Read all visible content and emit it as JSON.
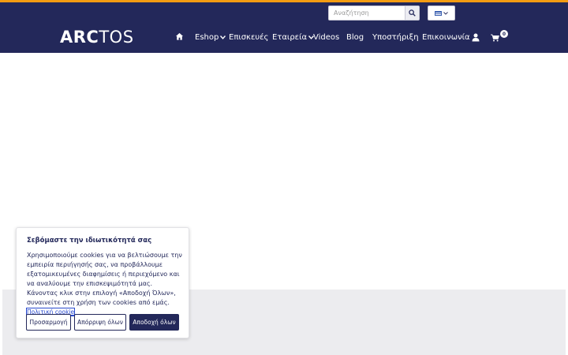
{
  "search": {
    "placeholder": "Αναζήτηση"
  },
  "header": {
    "logo_part1": "ARC",
    "logo_part2": "TOS"
  },
  "nav": {
    "eshop": "Eshop",
    "repairs": "Επισκευές",
    "company": "Εταιρεία",
    "videos": "Videos",
    "blog": "Blog",
    "support": "Υποστήριξη",
    "contact": "Επικοινωνία",
    "cart_count": "0"
  },
  "cookie": {
    "title": "Σεβόμαστε την ιδιωτικότητά σας",
    "text": "Χρησιμοποιούμε cookies για να βελτιώσουμε την εμπειρία περιήγησής σας, να προβάλλουμε εξατομικευμένες διαφημίσεις ή περιεχόμενο και να αναλύουμε την επισκεψιμότητά μας. Κάνοντας κλικ στην επιλογή «Αποδοχή Όλων», συναινείτε στη χρήση των cookies από εμάς.",
    "policy_link": "Πολιτική cookie",
    "customize_label": "Προσαρμογή",
    "reject_label": "Απόρριψη όλων",
    "accept_label": "Αποδοχή όλων"
  },
  "colors": {
    "brand_navy": "#23285a",
    "accent_orange": "#f39c12"
  }
}
